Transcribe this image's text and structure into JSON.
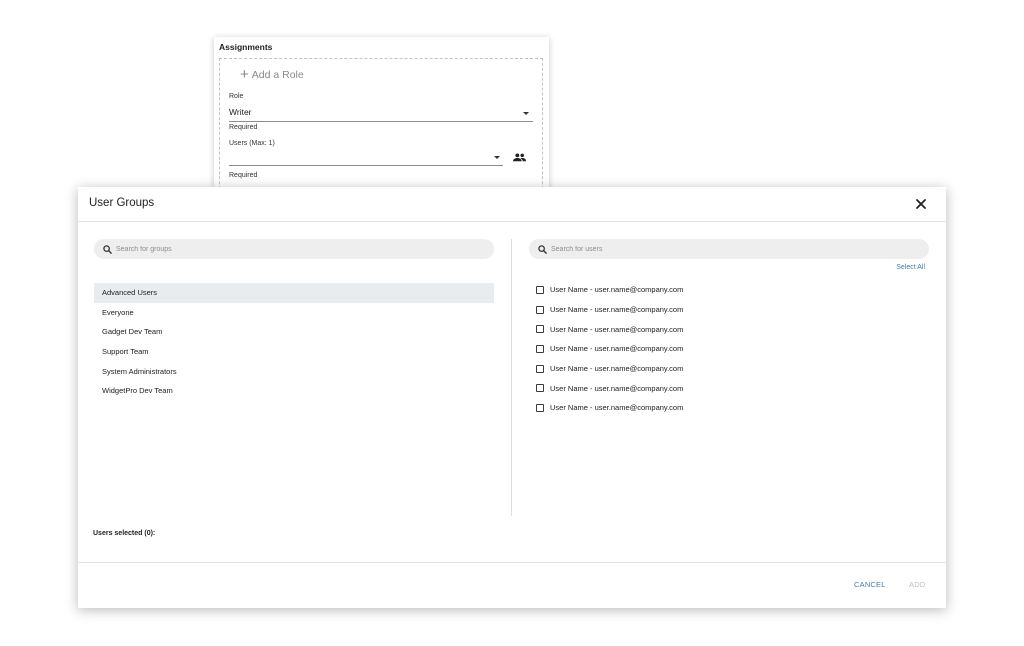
{
  "assignments": {
    "title": "Assignments",
    "add_role_label": "Add a Role",
    "role_label": "Role",
    "role_value": "Writer",
    "role_helper": "Required",
    "users_label": "Users (Max: 1)",
    "users_value": "",
    "users_helper": "Required"
  },
  "dialog": {
    "title": "User Groups",
    "groups_search_placeholder": "Search for groups",
    "users_search_placeholder": "Search for users",
    "select_all_label": "Select All",
    "groups": [
      {
        "label": "Advanced Users",
        "active": true
      },
      {
        "label": "Everyone"
      },
      {
        "label": "Gadget Dev Team"
      },
      {
        "label": "Support Team"
      },
      {
        "label": "System Administrators"
      },
      {
        "label": "WidgetPro Dev Team"
      }
    ],
    "users": [
      {
        "label": "User Name - user.name@company.com",
        "checked": false
      },
      {
        "label": "User Name - user.name@company.com",
        "checked": false
      },
      {
        "label": "User Name - user.name@company.com",
        "checked": false
      },
      {
        "label": "User Name - user.name@company.com",
        "checked": false
      },
      {
        "label": "User Name - user.name@company.com",
        "checked": false
      },
      {
        "label": "User Name - user.name@company.com",
        "checked": false
      },
      {
        "label": "User Name - user.name@company.com",
        "checked": false
      }
    ],
    "users_selected_label": "Users selected (0):",
    "cancel_label": "CANCEL",
    "add_label": "ADD"
  },
  "colors": {
    "accent": "#3d7fb5",
    "active_row_bg": "#e8ecef",
    "search_bg": "#eeeeee",
    "disabled_text": "#bdbdbd"
  },
  "icons": [
    "plus-icon",
    "dropdown-caret-icon",
    "people-icon",
    "close-icon",
    "search-icon",
    "checkbox-icon"
  ]
}
